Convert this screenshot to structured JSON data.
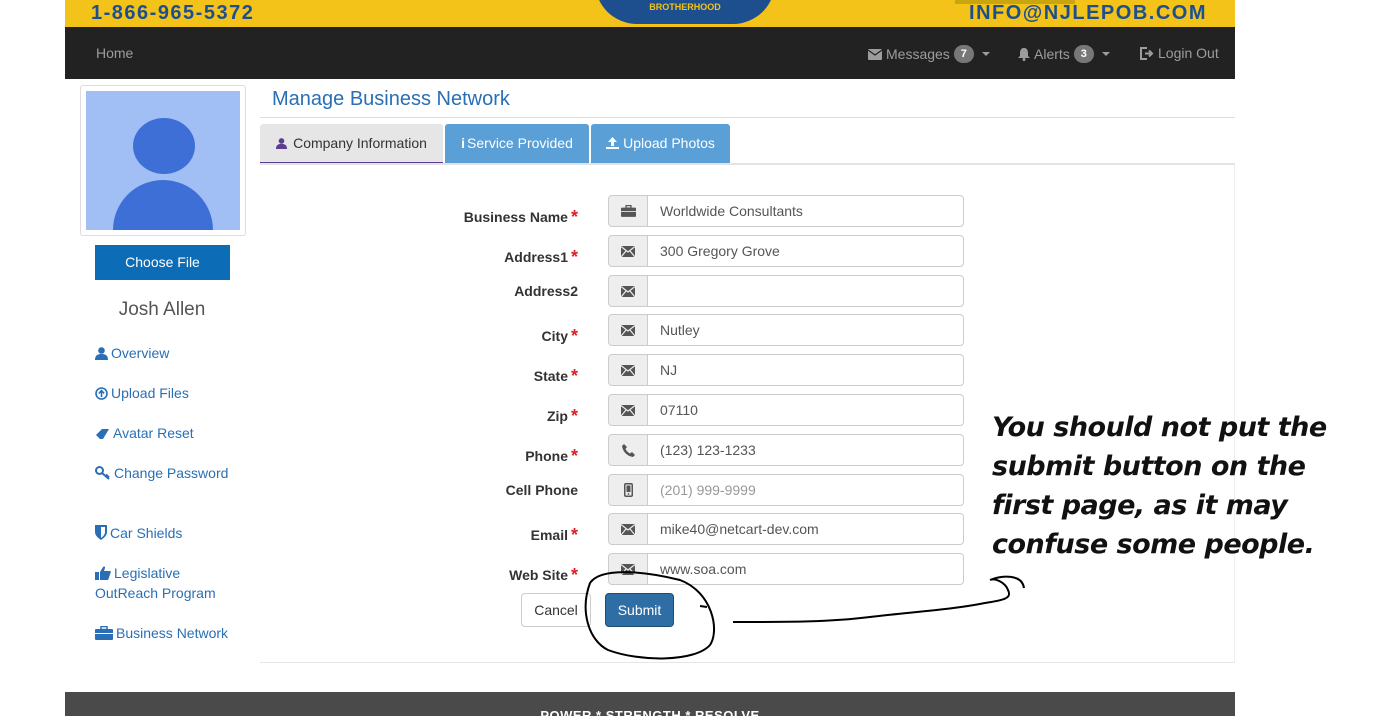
{
  "banner": {
    "phone": "1-866-965-5372",
    "email": "INFO@NJLEPOB.COM",
    "seal_text": "BROTHERHOOD"
  },
  "navbar": {
    "home": "Home",
    "messages": {
      "label": "Messages",
      "count": "7"
    },
    "alerts": {
      "label": "Alerts",
      "count": "3"
    },
    "login": "Login Out"
  },
  "sidebar": {
    "choose_file": "Choose File",
    "username": "Josh Allen",
    "links": [
      {
        "label": "Overview",
        "icon": "user-icon"
      },
      {
        "label": "Upload Files",
        "icon": "upload-circle-icon"
      },
      {
        "label": "Avatar Reset",
        "icon": "eraser-icon"
      },
      {
        "label": "Change Password",
        "icon": "key-icon"
      },
      {
        "label": "Car Shields",
        "icon": "shield-icon"
      },
      {
        "label": "Legislative OutReach Program",
        "icon": "thumbs-up-icon"
      },
      {
        "label": "Business Network",
        "icon": "briefcase-icon"
      }
    ]
  },
  "main": {
    "title": "Manage Business Network",
    "tabs": [
      {
        "label": "Company Information",
        "active": true
      },
      {
        "label": "Service Provided",
        "active": false
      },
      {
        "label": "Upload Photos",
        "active": false
      }
    ],
    "form": {
      "business_name": {
        "label": "Business Name",
        "value": "Worldwide Consultants",
        "required": true
      },
      "address1": {
        "label": "Address1",
        "value": "300 Gregory Grove",
        "required": true
      },
      "address2": {
        "label": "Address2",
        "value": "",
        "required": false
      },
      "city": {
        "label": "City",
        "value": "Nutley",
        "required": true
      },
      "state": {
        "label": "State",
        "value": "NJ",
        "required": true
      },
      "zip": {
        "label": "Zip",
        "value": "07110",
        "required": true
      },
      "phone": {
        "label": "Phone",
        "value": "(123) 123-1233",
        "required": true
      },
      "cell_phone": {
        "label": "Cell Phone",
        "value": "",
        "placeholder": "(201) 999-9999",
        "required": false
      },
      "email": {
        "label": "Email",
        "value": "mike40@netcart-dev.com",
        "required": true
      },
      "website": {
        "label": "Web Site",
        "value": "www.soa.com",
        "required": true
      },
      "required_mark": "*",
      "cancel": "Cancel",
      "submit": "Submit"
    }
  },
  "annotation": "You should not put the submit button on the first page, as it may confuse some people.",
  "footer": {
    "motto": "POWER * STRENGTH * RESOLVE"
  },
  "colors": {
    "nav_bg": "#222222",
    "banner": "#f3c31a",
    "link": "#2a6fb5",
    "primary": "#2f6ea5",
    "tab_blue": "#5a9fd6",
    "required": "#d9232a"
  }
}
